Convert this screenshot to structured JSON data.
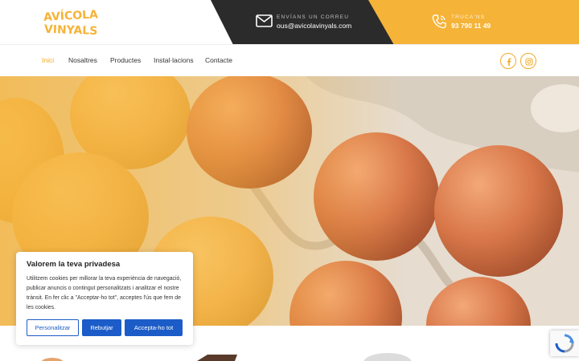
{
  "brand": {
    "logo_line1": "AVÍCOLA",
    "logo_line2": "VINYALS"
  },
  "header": {
    "email_label": "Envíans un correu",
    "email_value": "ous@avicolavinyals.com",
    "phone_label": "Truca'ns",
    "phone_value": "93 790 11 49"
  },
  "nav": {
    "items": [
      {
        "label": "Inici"
      },
      {
        "label": "Nosaltres"
      },
      {
        "label": "Productes"
      },
      {
        "label": "Instal·lacions"
      },
      {
        "label": "Contacte"
      }
    ],
    "active": "Inici"
  },
  "social": [
    "facebook-icon",
    "instagram-icon"
  ],
  "cookie": {
    "title": "Valorem la teva privadesa",
    "text": "Utilitzem cookies per millorar la teva experiència de navegació, publicar anuncis o contingut personalitzats i analitzar el nostre trànsit. En fer clic a \"Acceptar-ho tot\", acceptes l'ús que fem de les cookies.",
    "btn_customize": "Personalitzar",
    "btn_reject": "Rebutjar",
    "btn_accept": "Accepta-ho tot"
  },
  "colors": {
    "accent": "#f5b338",
    "dark": "#2b2b2b",
    "button": "#1c5cc8"
  }
}
